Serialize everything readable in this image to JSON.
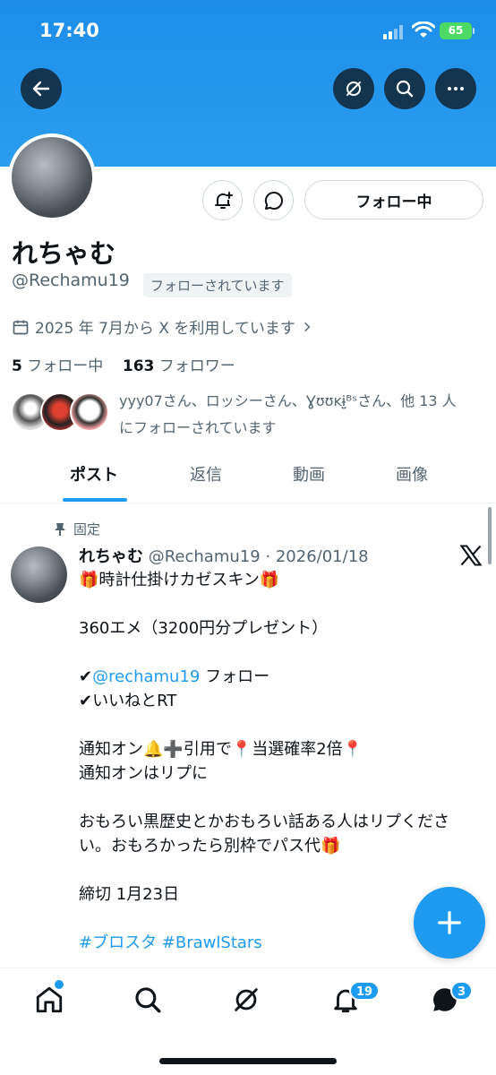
{
  "status_bar": {
    "time": "17:40",
    "battery": "65"
  },
  "profile": {
    "name": "れちゃむ",
    "handle": "@Rechamu19",
    "follows_you": "フォローされています",
    "joined": "2025 年 7月から X を利用しています",
    "following_count": "5",
    "following_label": "フォロー中",
    "followers_count": "163",
    "followers_label": "フォロワー",
    "followed_by_line1": "yyy07さん、ロッシーさん、Ɣʊʊᴋɨ̤̮ᴮˢさん、他 13 人",
    "followed_by_line2": "にフォローされています",
    "follow_button": "フォロー中"
  },
  "tabs": [
    "ポスト",
    "返信",
    "動画",
    "画像"
  ],
  "post": {
    "pinned_label": "固定",
    "author": "れちゃむ",
    "meta": "@Rechamu19 · 2026/01/18",
    "lines": [
      "🎁時計仕掛けカゼスキン🎁",
      "",
      "360エメ（3200円分プレゼント）",
      "",
      "✔",
      "✔いいねとRT",
      "",
      "通知オン🔔➕引用で📍当選確率2倍📍",
      "通知オンはリプに",
      "",
      "おもろい黒歴史とかおもろい話ある人はリプくださ",
      "い。おもろかったら別枠でパス代🎁",
      "",
      "締切 1月23日",
      ""
    ],
    "mention": "@rechamu19",
    "mention_rest": " フォロー",
    "hashtags": "#ブロスタ #BrawlStars"
  },
  "nav_badges": {
    "notifications": "19",
    "messages": "3"
  },
  "colors": {
    "accent": "#1d9bf0",
    "banner": "#2a9df0"
  },
  "icons": [
    "back-arrow-icon",
    "grok-icon",
    "search-icon",
    "more-icon",
    "bell-plus-icon",
    "message-icon",
    "calendar-icon",
    "chevron-right-icon",
    "pin-icon",
    "x-logo-icon",
    "plus-icon",
    "home-icon",
    "bell-icon",
    "mail-icon"
  ]
}
